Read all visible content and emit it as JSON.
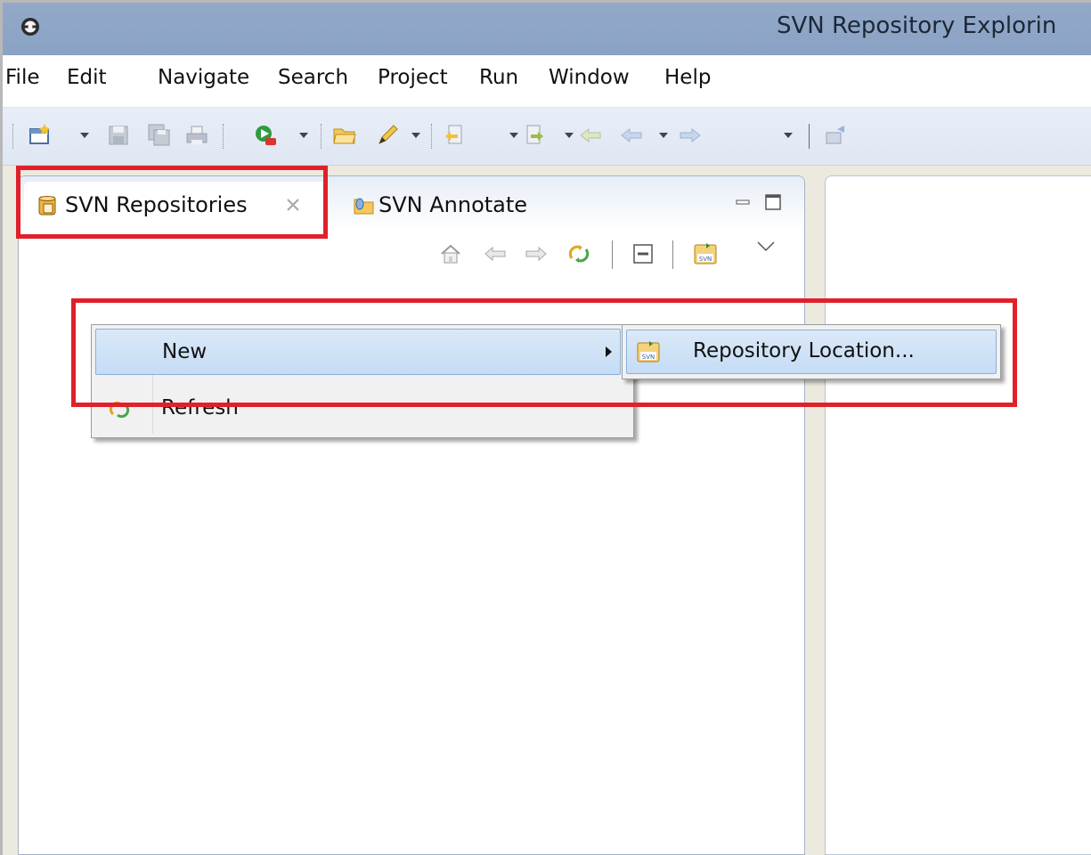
{
  "window": {
    "title": "SVN Repository Explorin"
  },
  "menubar": {
    "items": [
      "File",
      "Edit",
      "Navigate",
      "Search",
      "Project",
      "Run",
      "Window",
      "Help"
    ]
  },
  "toolbar": {
    "icons": [
      "new-wizard-icon",
      "save-icon",
      "save-all-icon",
      "print-icon",
      "run-icon",
      "open-folder-icon",
      "pencil-icon",
      "next-annotation-icon",
      "prev-annotation-icon",
      "back-icon",
      "forward-icon",
      "pin-icon"
    ]
  },
  "view": {
    "tabs": [
      {
        "label": "SVN Repositories",
        "icon": "repository-icon",
        "active": true
      },
      {
        "label": "SVN Annotate",
        "icon": "annotate-icon",
        "active": false
      }
    ],
    "toolbar_icons": [
      "home-icon",
      "back-arrow-icon",
      "forward-arrow-icon",
      "refresh-icon",
      "collapse-all-icon",
      "new-repository-location-icon",
      "view-menu-icon"
    ]
  },
  "context_menu": {
    "items": [
      {
        "label": "New",
        "has_submenu": true,
        "highlighted": true
      },
      {
        "label": "Refresh",
        "icon": "refresh-icon"
      }
    ]
  },
  "submenu": {
    "items": [
      {
        "label": "Repository Location...",
        "icon": "svn-repository-location-icon"
      }
    ]
  },
  "colors": {
    "titlebar": "#8aa2c4",
    "highlight_box": "#e0202a",
    "menu_selection": "#c5dcf5"
  }
}
